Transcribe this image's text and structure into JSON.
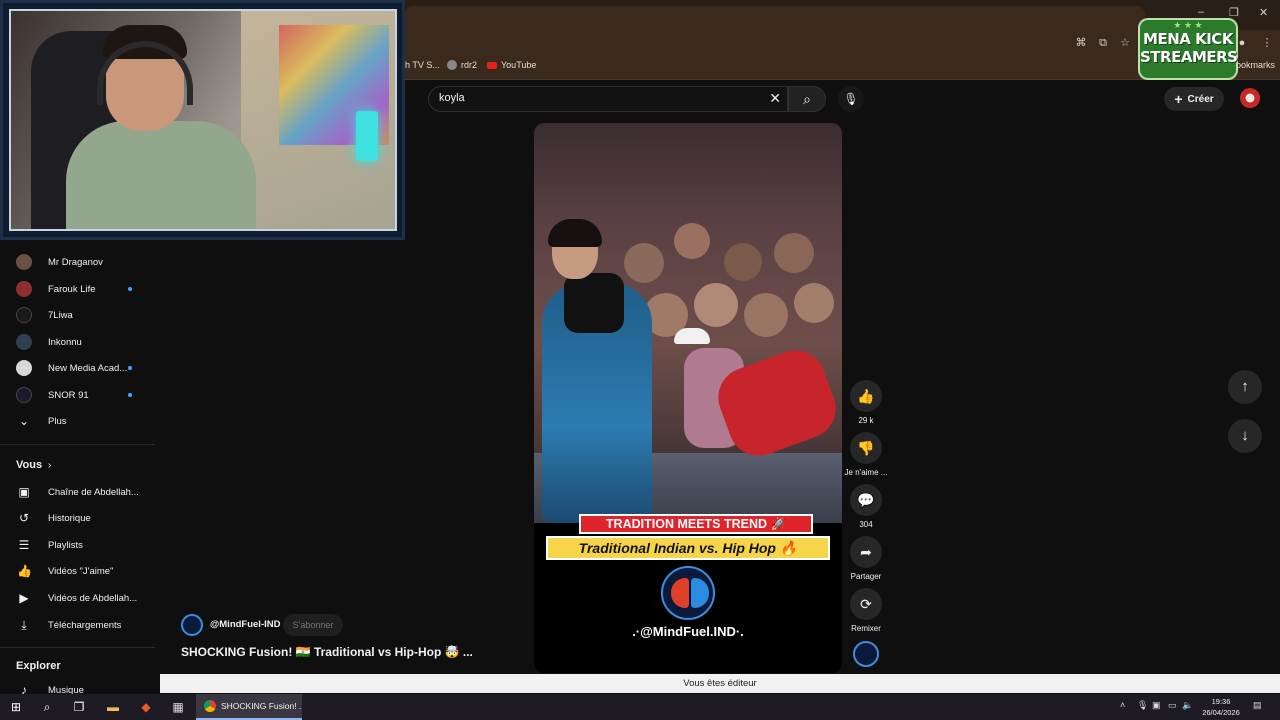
{
  "browser": {
    "bookmarks": [
      {
        "label": "h TV S...",
        "icon": "tv-icon"
      },
      {
        "label": "rdr2",
        "icon": "globe-icon"
      },
      {
        "label": "YouTube",
        "icon": "youtube-icon"
      }
    ],
    "bookmarks_tail": "ookmarks"
  },
  "overlay_logo": {
    "line1": "MENA KICK",
    "line2": "STREAMERS"
  },
  "header": {
    "search_value": "koyla",
    "create_label": "Créer"
  },
  "sidebar": {
    "subscriptions": [
      {
        "label": "Mr Draganov",
        "dot": false,
        "color": "#6a5040"
      },
      {
        "label": "Farouk Life",
        "dot": true,
        "color": "#8a3030"
      },
      {
        "label": "7Liwa",
        "dot": false,
        "color": "#1a1a1a"
      },
      {
        "label": "Inkonnu",
        "dot": false,
        "color": "#304050"
      },
      {
        "label": "New Media Acad...",
        "dot": true,
        "color": "#d8d8d8"
      },
      {
        "label": "SNOR 91",
        "dot": true,
        "color": "#1a1a2a"
      }
    ],
    "more_label": "Plus",
    "you_title": "Vous",
    "you_items": [
      {
        "label": "Chaîne de Abdellah...",
        "icon": "channel-icon"
      },
      {
        "label": "Historique",
        "icon": "history-icon"
      },
      {
        "label": "Playlists",
        "icon": "playlist-icon"
      },
      {
        "label": "Vidéos \"J'aime\"",
        "icon": "thumbs-up-icon"
      },
      {
        "label": "Vidéos de Abdellah...",
        "icon": "video-icon"
      },
      {
        "label": "Téléchargements",
        "icon": "download-icon"
      }
    ],
    "explore_title": "Explorer",
    "explore_items": [
      {
        "label": "Musique",
        "icon": "music-icon"
      }
    ]
  },
  "short": {
    "banner_top": "TRADITION MEETS TREND 🚀",
    "banner_bottom": "Traditional Indian vs. Hip Hop 🔥",
    "handle": ".·@MindFuel.IND·."
  },
  "actions": {
    "like_count": "29 k",
    "dislike_label": "Je n'aime ...",
    "comments_count": "304",
    "share_label": "Partager",
    "remix_label": "Remixer"
  },
  "channel": {
    "name": "@MindFuel-IND",
    "subscribe_label": "S'abonner",
    "title": "SHOCKING Fusion! 🇮🇳 Traditional vs Hip-Hop 🤯 ..."
  },
  "editor_notice": "Vous êtes éditeur",
  "taskbar": {
    "chrome_tab_label": "SHOCKING Fusion! ...",
    "time": "19:36",
    "date": "26/04/2026"
  }
}
